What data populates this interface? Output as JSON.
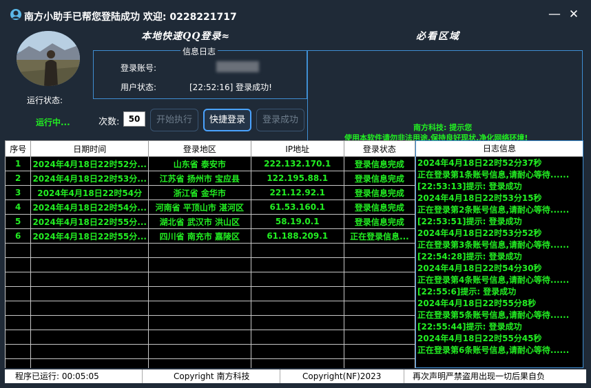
{
  "title": {
    "text": "南方小助手已帮您登陆成功  欢迎: 0228221717",
    "icon": "app-logo-icon",
    "minimize_icon": "minimize-icon",
    "close_icon": "close-icon"
  },
  "left": {
    "run_status_label": "运行状态:",
    "run_status_value": "运行中..."
  },
  "headings": {
    "login": "本地快速QQ登录≈",
    "must_see": "必看区域"
  },
  "info": {
    "legend": "信息日志",
    "account_label": "登录账号:",
    "user_status_label": "用户状态:",
    "user_status_value": "[22:52:16] 登录成功!"
  },
  "notice": {
    "title": "南方科技: 提示您",
    "text": "使用本软件请勿非法用途,保持良好现状,净化网络环境!"
  },
  "controls": {
    "count_label": "次数:",
    "count_value": "50",
    "start_button": "开始执行",
    "quick_button": "快捷登录",
    "success_button": "登录成功"
  },
  "table": {
    "columns": [
      "序号",
      "日期时间",
      "登录地区",
      "IP地址",
      "登录状态"
    ],
    "rows": [
      [
        "1",
        "2024年4月18日22时52分...",
        "山东省 泰安市",
        "222.132.170.1",
        "登录信息完成"
      ],
      [
        "2",
        "2024年4月18日22时53分...",
        "江苏省 扬州市 宝应县",
        "122.195.88.1",
        "登录信息完成"
      ],
      [
        "3",
        "2024年4月18日22时54分",
        "浙江省 金华市",
        "221.12.92.1",
        "登录信息完成"
      ],
      [
        "4",
        "2024年4月18日22时54分...",
        "河南省 平顶山市 湛河区",
        "61.53.160.1",
        "登录信息完成"
      ],
      [
        "5",
        "2024年4月18日22时55分...",
        "湖北省 武汉市 洪山区",
        "58.19.0.1",
        "登录信息完成"
      ],
      [
        "6",
        "2024年4月18日22时55分...",
        "四川省 南充市 嘉陵区",
        "61.188.209.1",
        "正在登录信息..."
      ]
    ],
    "empty_rows": 9
  },
  "log": {
    "header": "日志信息",
    "lines": [
      "2024年4月18日22时52分37秒",
      "正在登录第1条账号信息,请耐心等待......",
      "[22:53:13]提示: 登录成功",
      "2024年4月18日22时53分15秒",
      "正在登录第2条账号信息,请耐心等待......",
      "[22:53:51]提示: 登录成功",
      "2024年4月18日22时53分52秒",
      "正在登录第3条账号信息,请耐心等待......",
      "[22:54:28]提示: 登录成功",
      "2024年4月18日22时54分30秒",
      "正在登录第4条账号信息,请耐心等待......",
      "[22:55:6]提示: 登录成功",
      "2024年4月18日22时55分8秒",
      "正在登录第5条账号信息,请耐心等待......",
      "[22:55:44]提示: 登录成功",
      "2024年4月18日22时55分45秒",
      "正在登录第6条账号信息,请耐心等待......"
    ]
  },
  "statusbar": {
    "uptime": "程序已运行: 00:05:05",
    "copyright1": "Copyright 南方科技",
    "copyright2": "Copyright(NF)2023",
    "disclaimer": "再次声明严禁盗用出现一切后果自负"
  },
  "colors": {
    "background": "#1f2a37",
    "accent_border": "#3f8fd4",
    "log_green": "#22ee22"
  }
}
